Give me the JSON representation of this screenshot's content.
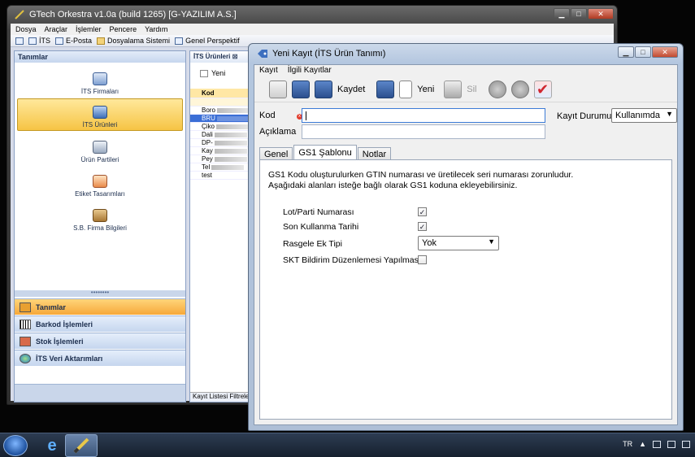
{
  "main_window": {
    "title": "GTech Orkestra v1.0a (build 1265) [G-YAZILIM A.S.]",
    "controls": {
      "minimize": "▁",
      "maximize": "□",
      "close": "✕"
    },
    "menu": [
      "Dosya",
      "Araçlar",
      "İşlemler",
      "Pencere",
      "Yardım"
    ],
    "toolbar": [
      "İTS",
      "E-Posta",
      "Dosyalama Sistemi",
      "Genel Perspektif"
    ],
    "left_panel": {
      "header": "Tanımlar",
      "items": [
        "İTS Firmaları",
        "İTS Ürünleri",
        "Ürün Partileri",
        "Etiket Tasarımları",
        "S.B. Firma Bilgileri"
      ],
      "selected_index": 1,
      "grip": "••••••••",
      "groups": [
        "Tanımlar",
        "Barkod İşlemleri",
        "Stok İşlemleri",
        "İTS Veri Aktarımları"
      ]
    },
    "list_panel": {
      "tab": "İTS Ürünleri",
      "tab_close": "⊠",
      "new_label": "Yeni",
      "column": "Kod",
      "rows": [
        "Boro",
        "BRU",
        "Çiko",
        "Dali",
        "DP-",
        "Kay",
        "Pey",
        "Tel",
        "test"
      ],
      "selected_index": 1,
      "footer_tabs": [
        "Kayıt Listesi",
        "Filtreler"
      ]
    }
  },
  "dialog": {
    "title": "Yeni Kayıt (İTS Ürün Tanımı)",
    "controls": {
      "minimize": "▁",
      "maximize": "□",
      "close": "✕"
    },
    "menu": [
      "Kayıt",
      "İlgili Kayıtlar"
    ],
    "toolbar": {
      "save_label": "Kaydet",
      "new_label": "Yeni",
      "delete_label": "Sil"
    },
    "fields": {
      "kod_label": "Kod",
      "kod_value": "",
      "aciklama_label": "Açıklama",
      "aciklama_value": "",
      "status_label": "Kayıt Durumu",
      "status_value": "Kullanımda"
    },
    "tabs": [
      "Genel",
      "GS1 Şablonu",
      "Notlar"
    ],
    "active_tab": 1,
    "gs1": {
      "info": "GS1 Kodu oluşturulurken GTIN numarası ve üretilecek seri numarası zorunludur.\nAşağıdaki alanları isteğe bağlı olarak GS1 koduna ekleyebilirsiniz.",
      "lot_label": "Lot/Parti Numarası",
      "lot_checked": true,
      "skt_label": "Son Kullanma Tarihi",
      "skt_checked": true,
      "random_label": "Rasgele Ek Tipi",
      "random_value": "Yok",
      "skt_notify_label": "SKT Bildirim Düzenlemesi Yapılmasın",
      "skt_notify_checked": false
    }
  },
  "taskbar": {
    "language": "TR",
    "ie_glyph": "e"
  }
}
